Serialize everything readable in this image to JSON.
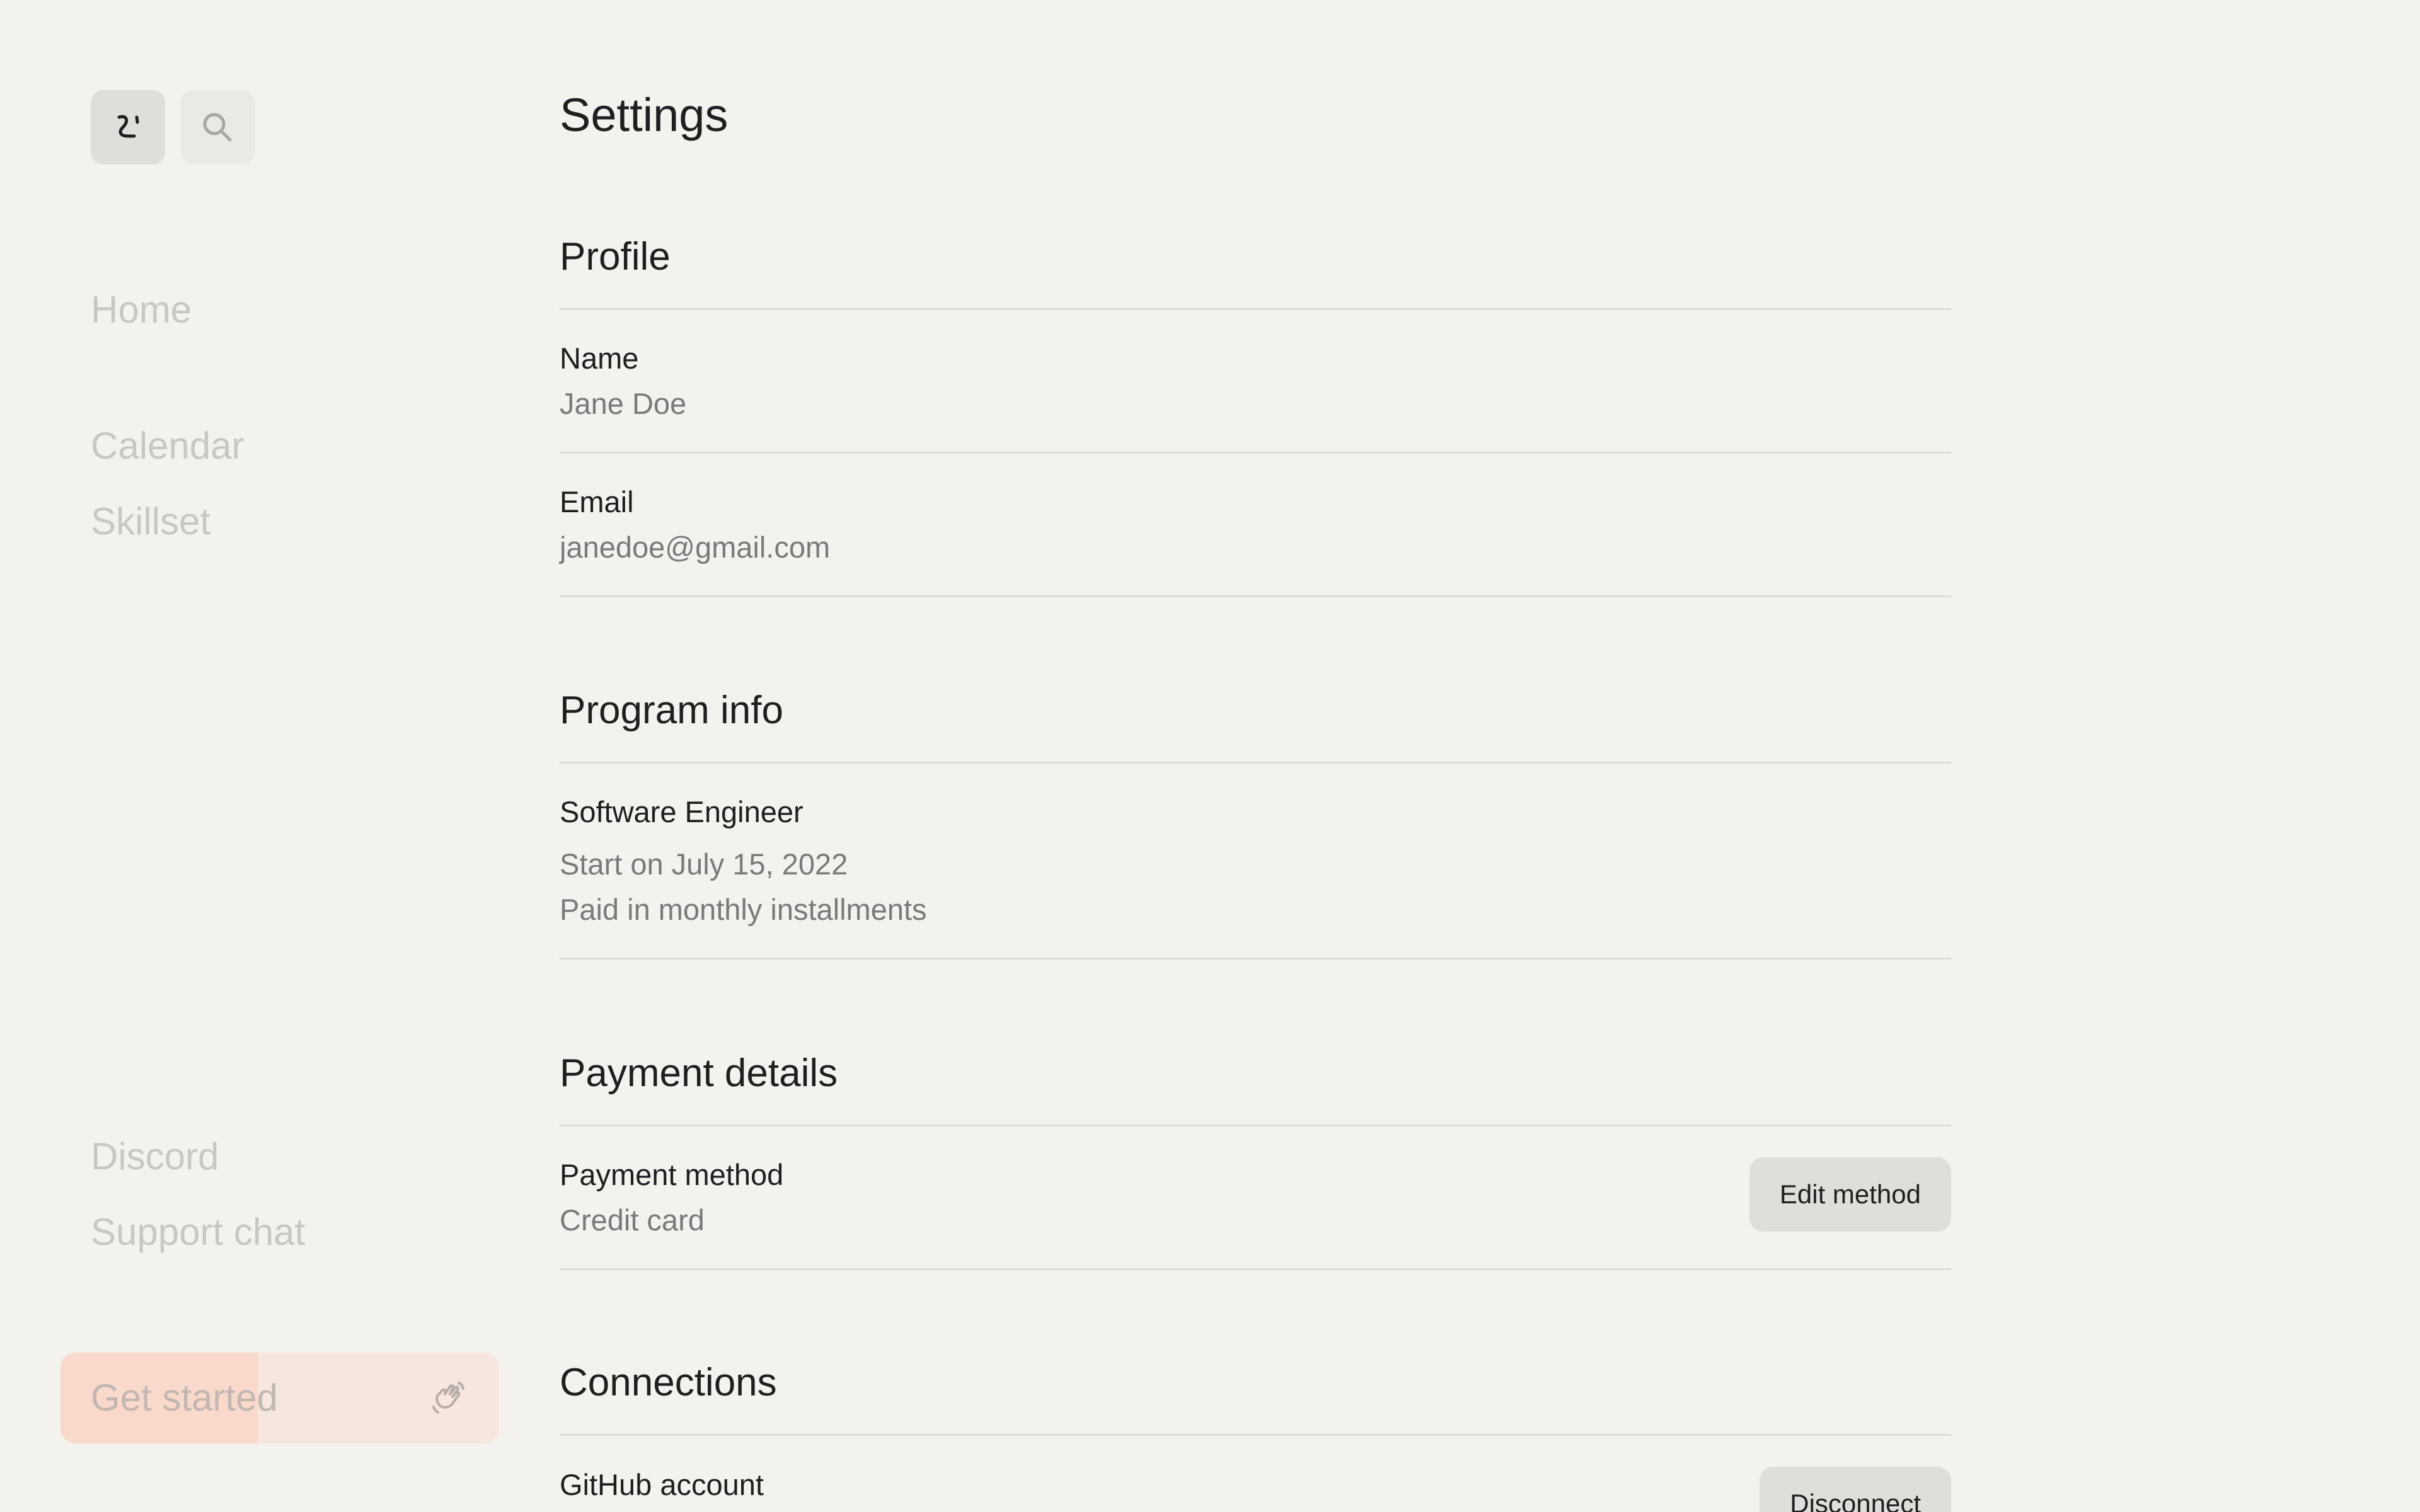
{
  "sidebar": {
    "nav_top": [
      {
        "label": "Home"
      },
      {
        "label": "Calendar"
      },
      {
        "label": "Skillset"
      }
    ],
    "nav_bottom": [
      {
        "label": "Discord"
      },
      {
        "label": "Support chat"
      }
    ],
    "get_started": {
      "label": "Get started",
      "progress_percent": 45
    }
  },
  "main": {
    "title": "Settings",
    "profile": {
      "title": "Profile",
      "name_label": "Name",
      "name_value": "Jane Doe",
      "email_label": "Email",
      "email_value": "janedoe@gmail.com"
    },
    "program": {
      "title": "Program info",
      "role": "Software Engineer",
      "start": "Start on July 15, 2022",
      "payment_plan": "Paid in monthly installments"
    },
    "payment": {
      "title": "Payment details",
      "method_label": "Payment method",
      "method_value": "Credit card",
      "edit_button": "Edit method"
    },
    "connections": {
      "title": "Connections",
      "github_label": "GitHub account",
      "disconnect_button": "Disconnect"
    }
  },
  "colors": {
    "background": "#f3f2ee",
    "accent_soft": "#f6e6df",
    "accent_fill": "#f8d9cc",
    "muted_text": "#7a7a7a",
    "nav_text": "#c9c7c2"
  },
  "icons": {
    "logo": "face-logo-icon",
    "search": "search-icon",
    "wave": "waving-hand-icon"
  }
}
